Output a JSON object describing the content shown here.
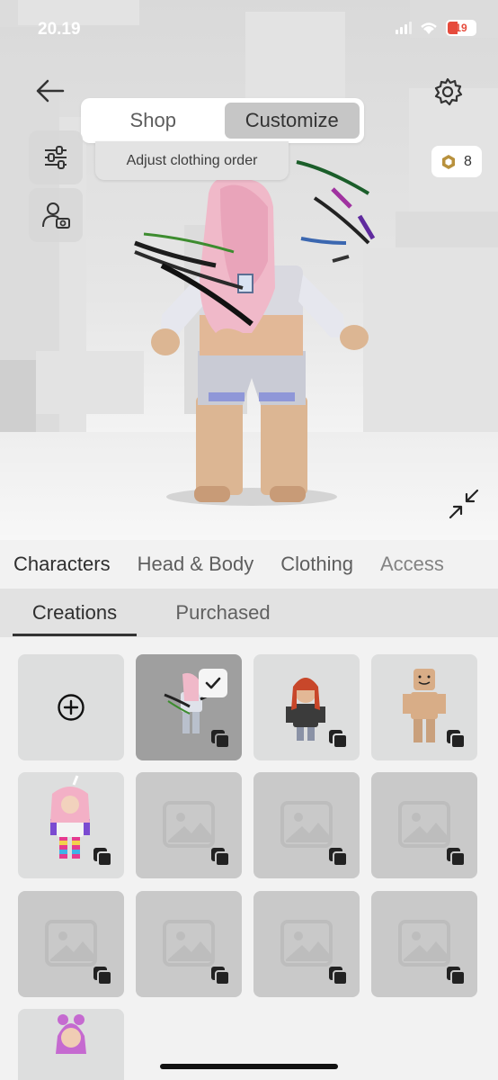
{
  "status_bar": {
    "time": "20.19",
    "battery": "19"
  },
  "toggle": {
    "shop": "Shop",
    "customize": "Customize",
    "active": "customize"
  },
  "tooltip": "Adjust clothing order",
  "robux": {
    "count": "8"
  },
  "category_tabs": [
    {
      "label": "Characters",
      "active": true
    },
    {
      "label": "Head & Body",
      "active": false
    },
    {
      "label": "Clothing",
      "active": false
    },
    {
      "label": "Access",
      "active": false
    }
  ],
  "sub_tabs": [
    {
      "label": "Creations",
      "active": true
    },
    {
      "label": "Purchased",
      "active": false
    }
  ],
  "icons": {
    "back": "arrow-left-icon",
    "settings": "gear-icon",
    "adjust": "sliders-icon",
    "avatar_camera": "user-camera-icon",
    "robux": "robux-icon",
    "expand": "collapse-arrows-icon",
    "add": "plus-circle-icon",
    "check": "checkmark-icon",
    "stack": "stack-icon",
    "placeholder": "image-placeholder-icon"
  },
  "colors": {
    "active_segment": "#c6c6c6",
    "selected_tile": "#9f9f9f",
    "tile": "#c9c9c9",
    "battery_low": "#e64b3c"
  },
  "grid": {
    "tiles": [
      {
        "kind": "add"
      },
      {
        "kind": "character",
        "selected": true
      },
      {
        "kind": "character",
        "selected": false
      },
      {
        "kind": "character",
        "selected": false
      },
      {
        "kind": "character",
        "selected": false
      },
      {
        "kind": "placeholder"
      },
      {
        "kind": "placeholder"
      },
      {
        "kind": "placeholder"
      },
      {
        "kind": "placeholder"
      },
      {
        "kind": "placeholder"
      },
      {
        "kind": "placeholder"
      },
      {
        "kind": "placeholder"
      },
      {
        "kind": "character",
        "selected": false
      }
    ]
  }
}
